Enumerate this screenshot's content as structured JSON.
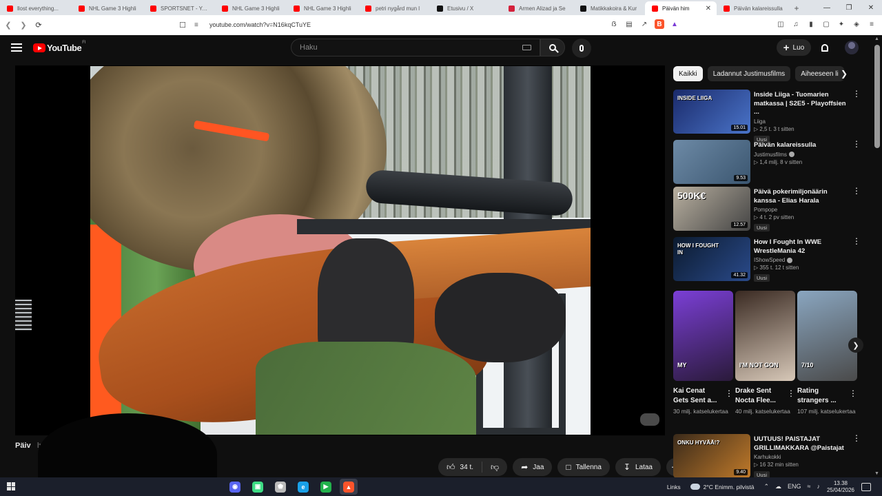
{
  "browser": {
    "tabs": [
      {
        "title": "llost everything...",
        "favicon_color": "#ff0000",
        "active": false
      },
      {
        "title": "NHL Game 3 Highli",
        "favicon_color": "#ff0000",
        "active": false
      },
      {
        "title": "SPORTSNET - YouTu",
        "favicon_color": "#ff0000",
        "active": false
      },
      {
        "title": "NHL Game 3 Highli",
        "favicon_color": "#ff0000",
        "active": false
      },
      {
        "title": "NHL Game 3 Highli",
        "favicon_color": "#ff0000",
        "active": false
      },
      {
        "title": "petri nygård mun l",
        "favicon_color": "#ff0000",
        "active": false
      },
      {
        "title": "Etusivu / X",
        "favicon_color": "#111111",
        "active": false
      },
      {
        "title": "Armen Alizad ja Se",
        "favicon_color": "#d4213b",
        "active": false
      },
      {
        "title": "Matikkakoira & Kur",
        "favicon_color": "#111111",
        "active": false
      },
      {
        "title": "Päivän him",
        "favicon_color": "#ff0000",
        "active": true
      },
      {
        "title": "Päivän kalareissulla",
        "favicon_color": "#ff0000",
        "active": false
      }
    ],
    "new_tab": "+",
    "window_controls": [
      "—",
      "❐",
      "✕"
    ],
    "url": "youtube.com/watch?v=N16kqCTuYE"
  },
  "youtube": {
    "logo_text": "YouTube",
    "country_code": "FI",
    "search_placeholder": "Haku",
    "create_label": "Luo",
    "video_title": "Päiv",
    "video_title_faint": "h",
    "actions": {
      "like_count": "34 t.",
      "share": "Jaa",
      "save": "Tallenna",
      "download": "Lataa"
    },
    "chips": [
      "Kaikki",
      "Ladannut Justimusfilms",
      "Aiheeseen li"
    ],
    "recommendations": [
      {
        "title": "Inside Liiga - Tuomarien matkassa | S2E5 - Playoffsien ...",
        "channel": "Liiga",
        "verified": false,
        "meta": "▷ 2,5 t.  3 t sitten",
        "badge": "Uusi",
        "duration": "15.01",
        "thumb_colors": [
          "#1a2a6a",
          "#4a74c9"
        ]
      },
      {
        "title": "Päivän kalareissulla",
        "channel": "Justimusfilms",
        "verified": true,
        "meta": "▷ 1,4 milj.  8 v sitten",
        "badge": "",
        "duration": "9.53",
        "thumb_colors": [
          "#6d8aa6",
          "#3b5670"
        ]
      },
      {
        "title": "Päivä pokerimiljonäärin kanssa - Elias Harala",
        "channel": "Pompope",
        "verified": false,
        "meta": "▷ 4 t.  2 pv sitten",
        "badge": "Uusi",
        "duration": "12.57",
        "thumb_colors": [
          "#b9b0a0",
          "#444444"
        ]
      },
      {
        "title": "How I Fought In WWE WrestleMania 42",
        "channel": "IShowSpeed",
        "verified": true,
        "meta": "▷ 355 t.  12 t sitten",
        "badge": "Uusi",
        "duration": "41.32",
        "thumb_colors": [
          "#0b1a2e",
          "#2a4a8a"
        ]
      },
      {
        "title": "UUTUUS! PAISTAJAT GRILLIMAKKARA @Paistajat",
        "channel": "Karhukokki",
        "verified": false,
        "meta": "▷ 16  32 min sitten",
        "badge": "Uusi",
        "duration": "9.40",
        "thumb_colors": [
          "#3a2a1a",
          "#c07a2a"
        ]
      }
    ],
    "thumb_text": {
      "inside_liiga": "INSIDE LIIGA",
      "poker": "500K€",
      "wwe": "HOW I FOUGHT IN",
      "onku": "ONKU HYVÄÄ!?"
    },
    "shorts": [
      {
        "title": "Kai Cenat Gets Sent a...",
        "views": "30 milj. katselukertaa",
        "overlay": "MY",
        "colors": [
          "#7b3fd6",
          "#2a1a3a"
        ]
      },
      {
        "title": "Drake Sent Nocta Flee...",
        "views": "40 milj. katselukertaa",
        "overlay": "I'M NOT GON",
        "colors": [
          "#3a2a22",
          "#d7c8b8"
        ]
      },
      {
        "title": "Rating strangers ...",
        "views": "107 milj. katselukertaa",
        "overlay": "7/10",
        "colors": [
          "#8aa6c0",
          "#4a4a4a"
        ]
      }
    ]
  },
  "taskbar": {
    "apps": [
      {
        "name": "discord",
        "color": "#5865f2",
        "glyph": "◉"
      },
      {
        "name": "android-studio",
        "color": "#3ddc84",
        "glyph": "▣"
      },
      {
        "name": "shield-app",
        "color": "#bbbbbb",
        "glyph": "⬟"
      },
      {
        "name": "edge",
        "color": "#1aa0e8",
        "glyph": "e"
      },
      {
        "name": "play-app",
        "color": "#22b14c",
        "glyph": "▶"
      },
      {
        "name": "brave",
        "color": "#fb542b",
        "glyph": "▲"
      }
    ],
    "links": "Links",
    "weather": "2°C  Enimm. pilvistä",
    "lang": "ENG",
    "time": "13.38",
    "date": "25/04/2026"
  }
}
